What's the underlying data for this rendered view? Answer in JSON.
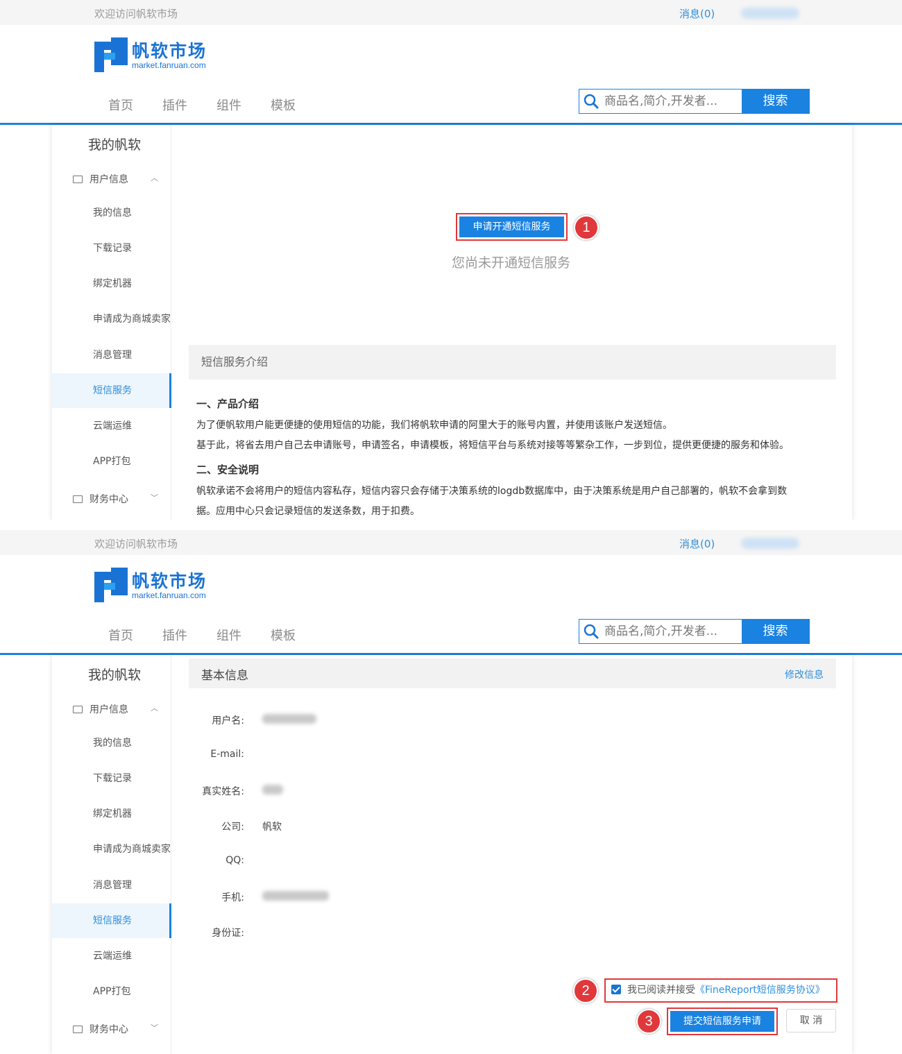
{
  "header": {
    "welcome": "欢迎访问帆软市场",
    "messages": "消息(0)",
    "logo_title": "帆软市场",
    "logo_url": "market.fanruan.com",
    "nav": [
      "首页",
      "插件",
      "组件",
      "模板"
    ],
    "search_placeholder": "商品名,简介,开发者...",
    "search_button": "搜索"
  },
  "sidebar": {
    "title": "我的帆软",
    "group_user": "用户信息",
    "items": [
      "我的信息",
      "下载记录",
      "绑定机器",
      "申请成为商城卖家",
      "消息管理",
      "短信服务",
      "云端运维",
      "APP打包"
    ],
    "group_finance": "财务中心",
    "active": "短信服务"
  },
  "panel1": {
    "apply_button": "申请开通短信服务",
    "badge": "1",
    "status": "您尚未开通短信服务",
    "intro_title": "短信服务介绍",
    "section1_title": "一、产品介绍",
    "section1_line1": "为了便帆软用户能更便捷的使用短信的功能，我们将帆软申请的阿里大于的账号内置，并使用该账户发送短信。",
    "section1_line2": "基于此，将省去用户自己去申请账号，申请签名，申请模板，将短信平台与系统对接等等繁杂工作，一步到位，提供更便捷的服务和体验。",
    "section2_title": "二、安全说明",
    "section2_line1": "帆软承诺不会将用户的短信内容私存，短信内容只会存储于决策系统的logdb数据库中，由于决策系统是用户自己部署的，帆软不会拿到数",
    "section2_line2": "据。应用中心只会记录短信的发送条数，用于扣费。"
  },
  "panel2": {
    "info_title": "基本信息",
    "edit_link": "修改信息",
    "fields": [
      {
        "label": "用户名:",
        "value": ""
      },
      {
        "label": "E-mail:",
        "value": ""
      },
      {
        "label": "真实姓名:",
        "value": ""
      },
      {
        "label": "公司:",
        "value": "帆软"
      },
      {
        "label": "QQ:",
        "value": ""
      },
      {
        "label": "手机:",
        "value": ""
      },
      {
        "label": "身份证:",
        "value": ""
      }
    ],
    "agree_text": "我已阅读并接受",
    "agree_link": "《FineReport短信服务协议》",
    "agree_checked": true,
    "badge2": "2",
    "submit_button": "提交短信服务申请",
    "badge3": "3",
    "cancel_button": "取 消"
  },
  "colors": {
    "brand_blue": "#1a82e0",
    "link_blue": "#2f8fdb",
    "highlight_red": "#e0383b"
  }
}
